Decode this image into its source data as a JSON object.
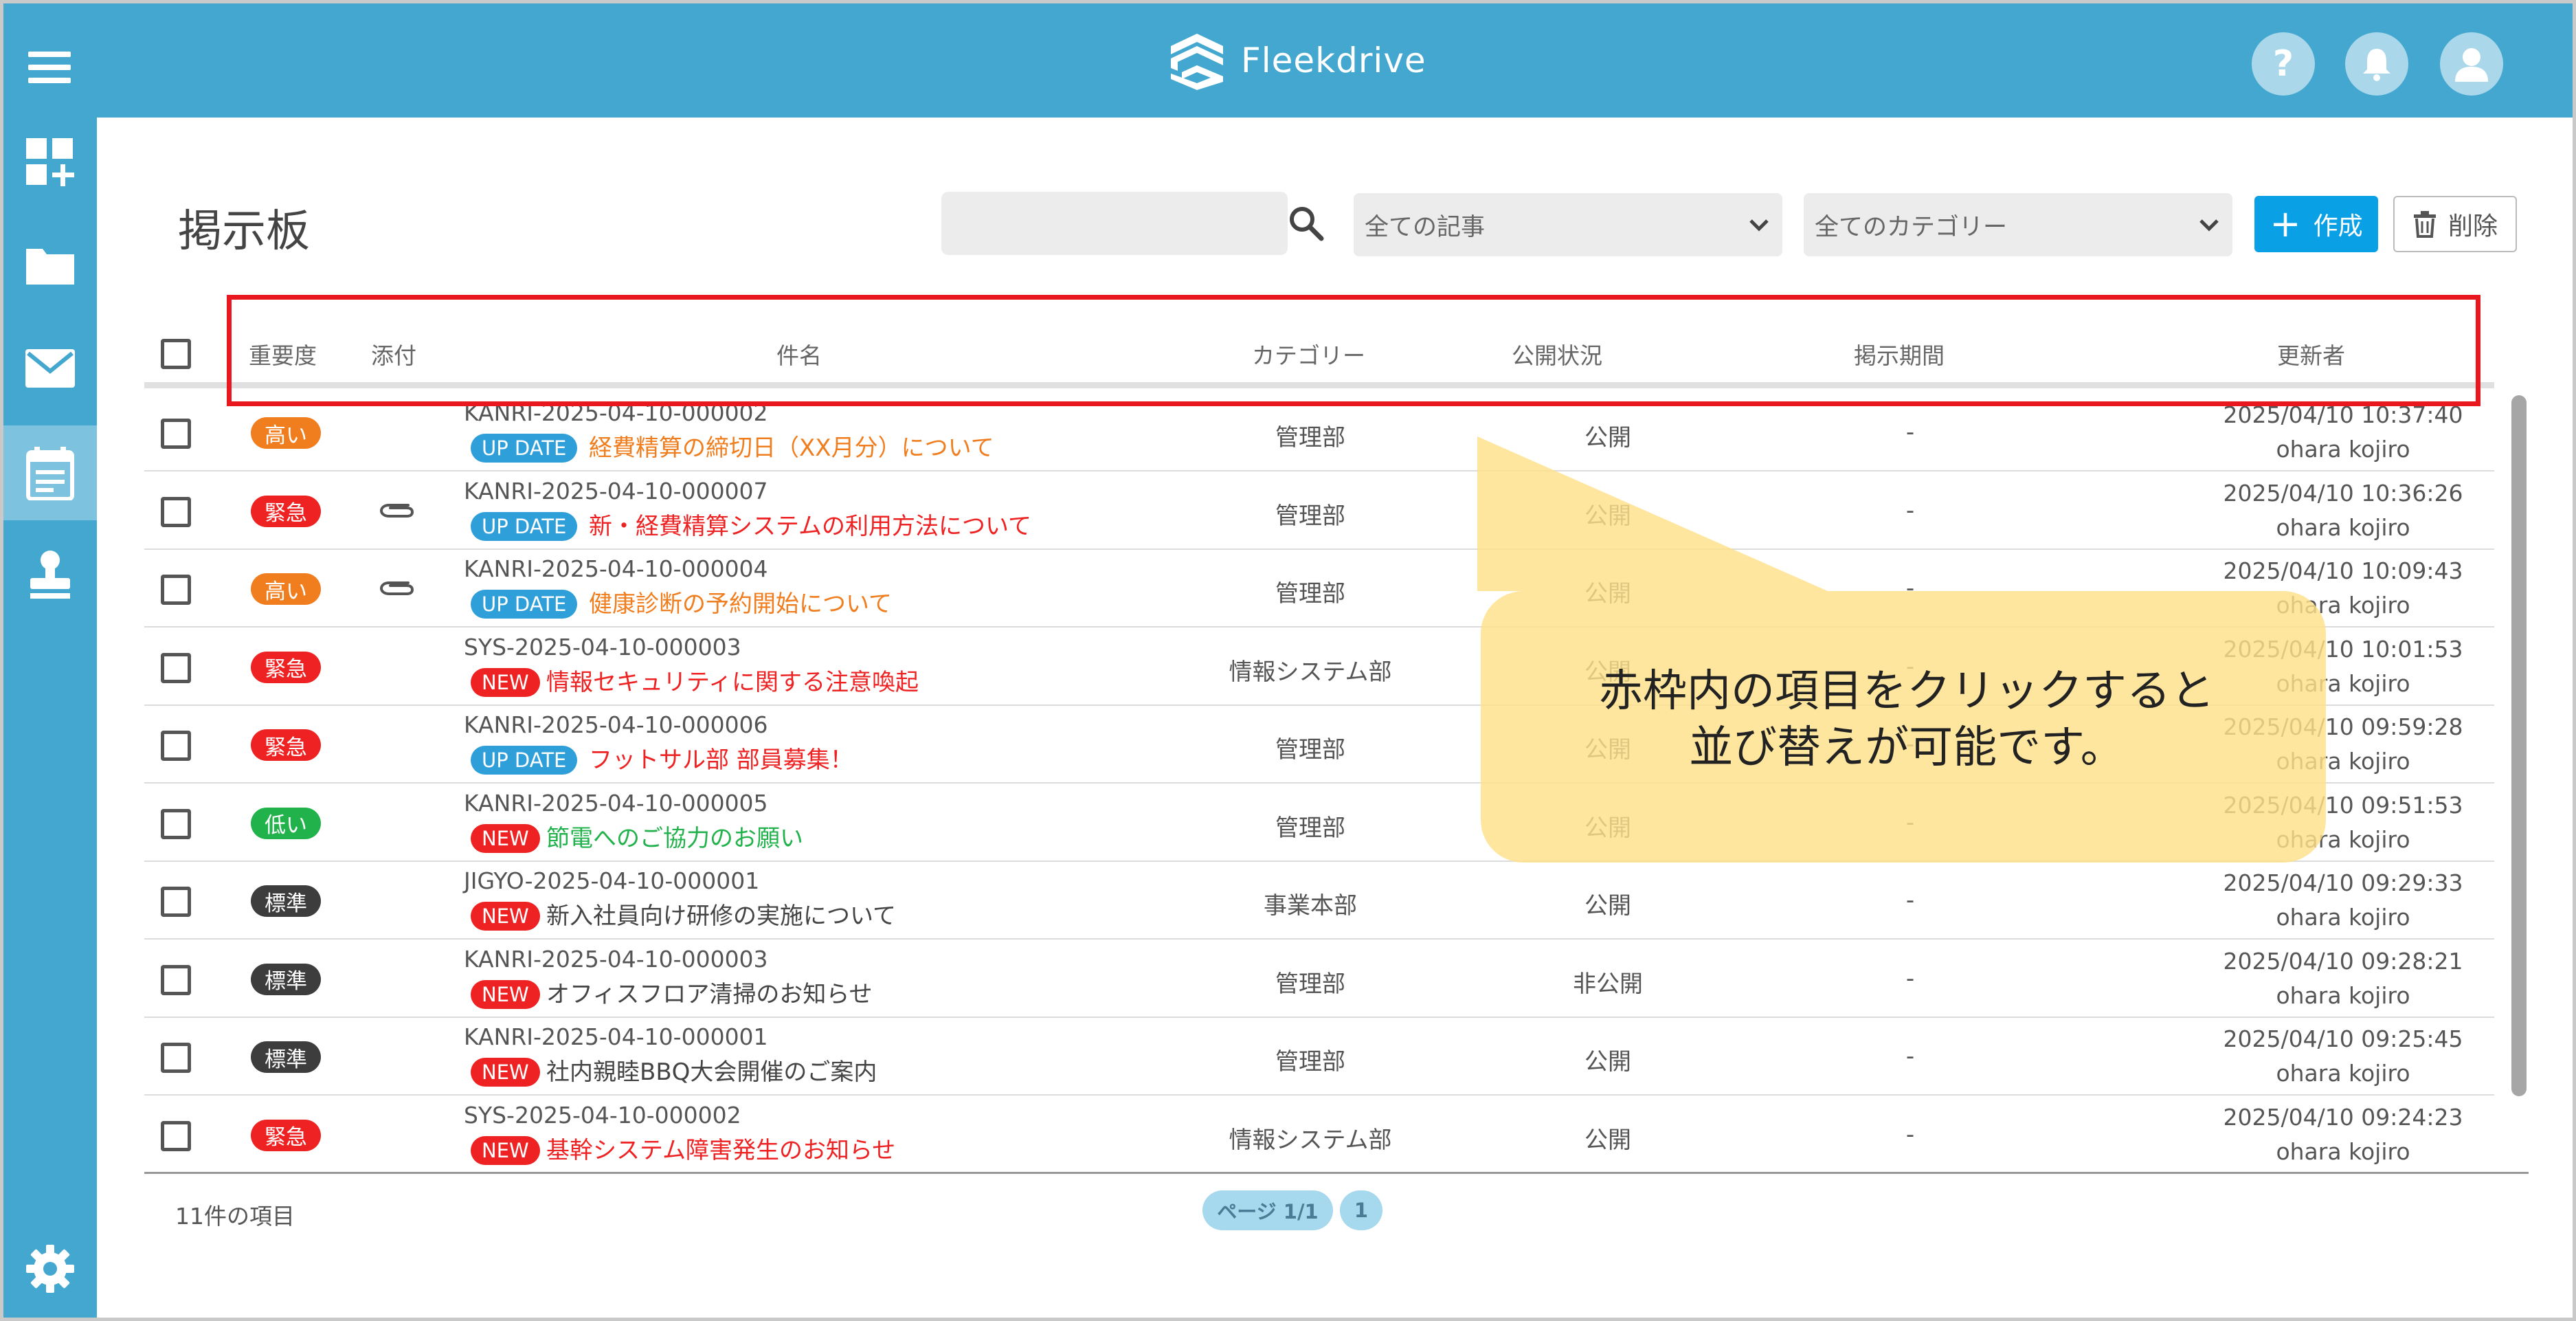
{
  "header": {
    "logo_text": "Fleekdrive",
    "help_label": "?"
  },
  "colors": {
    "header_bg": "#43a7d0",
    "accent_blue": "#0aa0e6",
    "annotation_red": "#e8181e",
    "callout_yellow": "#ffe08a"
  },
  "sidebar": {
    "items": [
      {
        "icon": "dashboard-add-icon"
      },
      {
        "icon": "folder-icon"
      },
      {
        "icon": "mail-icon"
      },
      {
        "icon": "bulletin-board-icon",
        "active": true
      },
      {
        "icon": "stamp-icon"
      },
      {
        "icon": "gear-icon"
      }
    ]
  },
  "page": {
    "title": "掲示板",
    "search_placeholder": "",
    "article_filter": "全ての記事",
    "category_filter": "全てのカテゴリー",
    "create_label": "作成",
    "delete_label": "削除"
  },
  "table": {
    "columns": [
      "重要度",
      "添付",
      "件名",
      "カテゴリー",
      "公開状況",
      "掲示期間",
      "更新者"
    ],
    "rows": [
      {
        "priority": "高い",
        "attach": false,
        "code": "KANRI-2025-04-10-000002",
        "badge": "UP DATE",
        "title": "経費精算の締切日（XX月分）について",
        "category": "管理部",
        "status": "公開",
        "period": "-",
        "updated": "2025/04/10 10:37:40",
        "user": "ohara kojiro"
      },
      {
        "priority": "緊急",
        "attach": true,
        "code": "KANRI-2025-04-10-000007",
        "badge": "UP DATE",
        "title": "新・経費精算システムの利用方法について",
        "category": "管理部",
        "status": "公開",
        "period": "-",
        "updated": "2025/04/10 10:36:26",
        "user": "ohara kojiro"
      },
      {
        "priority": "高い",
        "attach": true,
        "code": "KANRI-2025-04-10-000004",
        "badge": "UP DATE",
        "title": "健康診断の予約開始について",
        "category": "管理部",
        "status": "公開",
        "period": "-",
        "updated": "2025/04/10 10:09:43",
        "user": "ohara kojiro"
      },
      {
        "priority": "緊急",
        "attach": false,
        "code": "SYS-2025-04-10-000003",
        "badge": "NEW",
        "title": "情報セキュリティに関する注意喚起",
        "category": "情報システム部",
        "status": "公開",
        "period": "-",
        "updated": "2025/04/10 10:01:53",
        "user": "ohara kojiro"
      },
      {
        "priority": "緊急",
        "attach": false,
        "code": "KANRI-2025-04-10-000006",
        "badge": "UP DATE",
        "title": "フットサル部 部員募集！",
        "category": "管理部",
        "status": "公開",
        "period": "-",
        "updated": "2025/04/10 09:59:28",
        "user": "ohara kojiro"
      },
      {
        "priority": "低い",
        "attach": false,
        "code": "KANRI-2025-04-10-000005",
        "badge": "NEW",
        "title": "節電へのご協力のお願い",
        "category": "管理部",
        "status": "公開",
        "period": "-",
        "updated": "2025/04/10 09:51:53",
        "user": "ohara kojiro"
      },
      {
        "priority": "標準",
        "attach": false,
        "code": "JIGYO-2025-04-10-000001",
        "badge": "NEW",
        "title": "新入社員向け研修の実施について",
        "category": "事業本部",
        "status": "公開",
        "period": "-",
        "updated": "2025/04/10 09:29:33",
        "user": "ohara kojiro"
      },
      {
        "priority": "標準",
        "attach": false,
        "code": "KANRI-2025-04-10-000003",
        "badge": "NEW",
        "title": "オフィスフロア清掃のお知らせ",
        "category": "管理部",
        "status": "非公開",
        "period": "-",
        "updated": "2025/04/10 09:28:21",
        "user": "ohara kojiro"
      },
      {
        "priority": "標準",
        "attach": false,
        "code": "KANRI-2025-04-10-000001",
        "badge": "NEW",
        "title": "社内親睦BBQ大会開催のご案内",
        "category": "管理部",
        "status": "公開",
        "period": "-",
        "updated": "2025/04/10 09:25:45",
        "user": "ohara kojiro"
      },
      {
        "priority": "緊急",
        "attach": false,
        "code": "SYS-2025-04-10-000002",
        "badge": "NEW",
        "title": "基幹システム障害発生のお知らせ",
        "category": "情報システム部",
        "status": "公開",
        "period": "-",
        "updated": "2025/04/10 09:24:23",
        "user": "ohara kojiro"
      }
    ]
  },
  "footer": {
    "item_count": "11件の項目",
    "pager_label": "ページ 1/1",
    "pager_page": "1"
  },
  "annotation": {
    "line1": "赤枠内の項目をクリックすると",
    "line2": "並び替えが可能です。"
  }
}
